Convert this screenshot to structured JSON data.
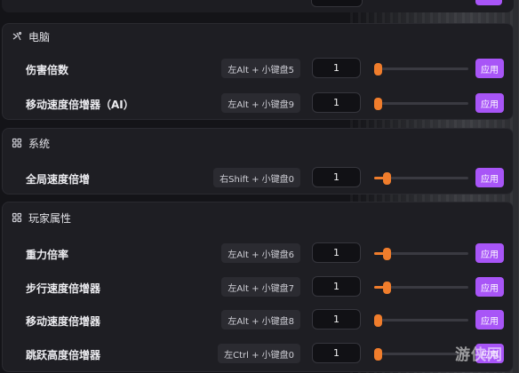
{
  "colors": {
    "accent": "#a855f7",
    "slider": "#f07d2c",
    "panel": "#1e1e23"
  },
  "sections": [
    {
      "title": "电脑",
      "icon": "pc-icon",
      "rows": [
        {
          "label": "伤害倍数",
          "hotkey": "左Alt + 小键盘5",
          "value": "1",
          "level": 0.0,
          "apply": "应用"
        },
        {
          "label": "移动速度倍增器（AI）",
          "hotkey": "左Alt + 小键盘9",
          "value": "1",
          "level": 0.0,
          "apply": "应用"
        }
      ]
    },
    {
      "title": "系统",
      "icon": "system-icon",
      "rows": [
        {
          "label": "全局速度倍增",
          "hotkey": "右Shift + 小键盘0",
          "value": "1",
          "level": 0.1,
          "apply": "应用"
        }
      ]
    },
    {
      "title": "玩家属性",
      "icon": "player-icon",
      "rows": [
        {
          "label": "重力倍率",
          "hotkey": "左Alt + 小键盘6",
          "value": "1",
          "level": 0.1,
          "apply": "应用"
        },
        {
          "label": "步行速度倍增器",
          "hotkey": "左Alt + 小键盘7",
          "value": "1",
          "level": 0.1,
          "apply": "应用"
        },
        {
          "label": "移动速度倍增器",
          "hotkey": "左Alt + 小键盘8",
          "value": "1",
          "level": 0.0,
          "apply": "应用"
        },
        {
          "label": "跳跃高度倍增器",
          "hotkey": "左Ctrl + 小键盘0",
          "value": "1",
          "level": 0.0,
          "apply": "应用"
        }
      ]
    }
  ],
  "watermark": {
    "line1": "游侠网"
  }
}
